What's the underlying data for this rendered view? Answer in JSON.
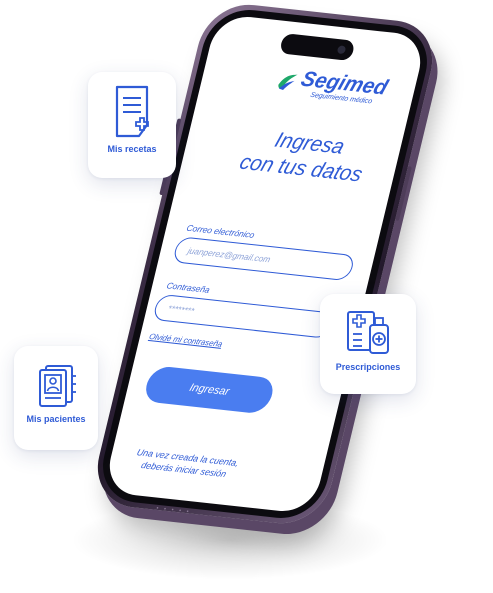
{
  "brand": {
    "name": "Segimed",
    "tagline": "Seguimiento médico",
    "primary_color": "#2f5bd6",
    "button_color": "#4a7df0"
  },
  "login": {
    "headline_line1": "Ingresa",
    "headline_line2": "con tus datos",
    "email_label": "Correo electrónico",
    "email_placeholder": "juanperez@gmail.com",
    "password_label": "Contraseña",
    "password_placeholder": "********",
    "forgot_link": "Olvidé mi contraseña",
    "submit_label": "Ingresar",
    "note_line1": "Una vez creada la cuenta,",
    "note_line2": "deberás iniciar sesión"
  },
  "cards": {
    "recetas": {
      "label": "Mis recetas",
      "icon": "prescription-document-icon"
    },
    "prescripciones": {
      "label": "Prescripciones",
      "icon": "medication-list-icon"
    },
    "pacientes": {
      "label": "Mis pacientes",
      "icon": "patient-records-icon"
    }
  },
  "device": {
    "frame_color": "#3b2c45"
  }
}
